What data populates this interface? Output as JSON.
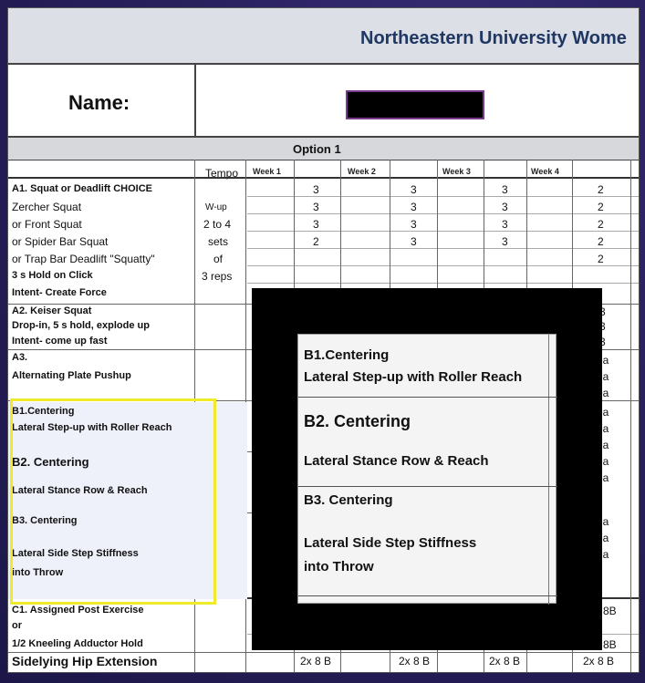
{
  "title": "Northeastern University Wome",
  "name_label": "Name:",
  "option": "Option 1",
  "headers": {
    "tempo": "Tempo",
    "week1": "Week 1",
    "week2": "Week 2",
    "week3": "Week 3",
    "week4": "Week 4"
  },
  "exercises": {
    "a1": [
      "A1. Squat or Deadlift CHOICE",
      "Zercher Squat",
      "or Front Squat",
      "or Spider Bar Squat",
      "or Trap Bar Deadlift \"Squatty\"",
      "3 s Hold on Click",
      "Intent- Create Force"
    ],
    "a2": [
      "A2. Keiser Squat",
      "Drop-in, 5 s hold, explode up",
      "Intent- come up fast"
    ],
    "a3": [
      "A3.",
      "Alternating Plate Pushup"
    ],
    "b1": [
      "B1.Centering",
      "Lateral Step-up with Roller Reach"
    ],
    "b2": [
      "B2. Centering",
      "Lateral Stance Row & Reach"
    ],
    "b3": [
      "B3. Centering",
      "Lateral Side Step Stiffness",
      "into Throw"
    ],
    "c1": [
      "C1. Assigned Post Exercise",
      "or",
      "1/2 Kneeling Adductor Hold",
      "Sidelying Hip Extension"
    ]
  },
  "tempo_values": [
    "W-up",
    "2 to 4",
    "sets",
    "of",
    "3 reps"
  ],
  "weeks_rows": [
    [
      "3",
      "3",
      "3",
      "2"
    ],
    [
      "3",
      "3",
      "3",
      "2"
    ],
    [
      "3",
      "3",
      "3",
      "2"
    ],
    [
      "2",
      "3",
      "3",
      "2"
    ],
    [
      "",
      "",
      "",
      "2"
    ]
  ],
  "right_edge": [
    "3",
    "3",
    "3",
    "ea",
    "ea",
    "ea",
    "ea",
    "ea",
    "ea",
    "ea",
    "ea",
    "ea",
    "ea",
    "ea"
  ],
  "c1_right": "8B",
  "c1_right2": "8B",
  "bottom_row": [
    "2x 8 B",
    "2x 8 B",
    "2x 8 B",
    "2x 8 B"
  ],
  "zoom": {
    "b1_title": "B1.Centering",
    "b1_line": "Lateral Step-up with Roller Reach",
    "b2_title": "B2. Centering",
    "b2_line": "Lateral Stance Row & Reach",
    "b3_title": "B3. Centering",
    "b3_line1": "Lateral Side Step Stiffness",
    "b3_line2": "into Throw"
  }
}
